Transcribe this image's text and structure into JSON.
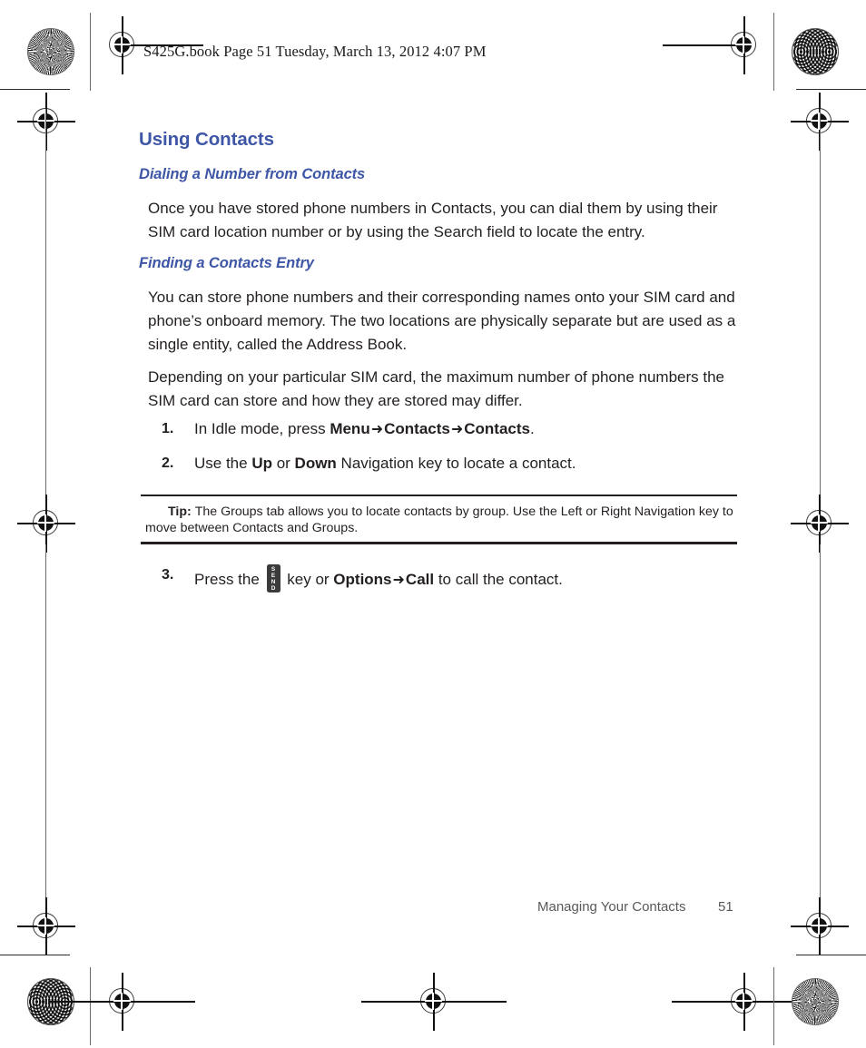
{
  "header": {
    "book_line": "S425G.book  Page 51  Tuesday, March 13, 2012  4:07 PM"
  },
  "document": {
    "section_title": "Using Contacts",
    "subsection_1": "Dialing a Number from Contacts",
    "paragraph_1": "Once you have stored phone numbers in Contacts, you can dial them by using their SIM card location number or by using the Search field to locate the entry.",
    "subsection_2": "Finding a Contacts Entry",
    "paragraph_2": "You can store phone numbers and their corresponding names onto your SIM card and phone’s onboard memory. The two locations are physically separate but are used as a single entity, called the Address Book.",
    "paragraph_3": "Depending on your particular SIM card, the maximum number of phone numbers the SIM card can store and how they are stored may differ."
  },
  "steps": [
    {
      "number": "1.",
      "lead": "In Idle mode, press ",
      "bold_1": "Menu",
      "arrow_1": "➜",
      "bold_2": "Contacts",
      "arrow_2": "➜",
      "bold_3": "Contacts",
      "tail": "."
    },
    {
      "number": "2.",
      "lead": "Use the ",
      "bold_1": "Up",
      "mid_1": " or ",
      "bold_2": "Down",
      "tail": " Navigation key to locate a contact."
    },
    {
      "number": "3.",
      "lead": "Press the ",
      "key_icon": "send-key",
      "key_letters": [
        "S",
        "E",
        "N",
        "D"
      ],
      "mid_1": " key or ",
      "bold_1": "Options",
      "arrow_1": "➜",
      "bold_2": "Call",
      "tail": " to call the contact."
    }
  ],
  "tip": {
    "label": "Tip:",
    "text": "The Groups tab allows you to locate contacts by group. Use the Left or Right Navigation key to move between Contacts and Groups."
  },
  "footer": {
    "chapter": "Managing Your Contacts",
    "page_number": "51"
  },
  "colors": {
    "heading_blue": "#3e56a6",
    "body_text": "#231f20",
    "footer_gray": "#58595b",
    "key_glyph_bg": "#3b3b3b"
  }
}
